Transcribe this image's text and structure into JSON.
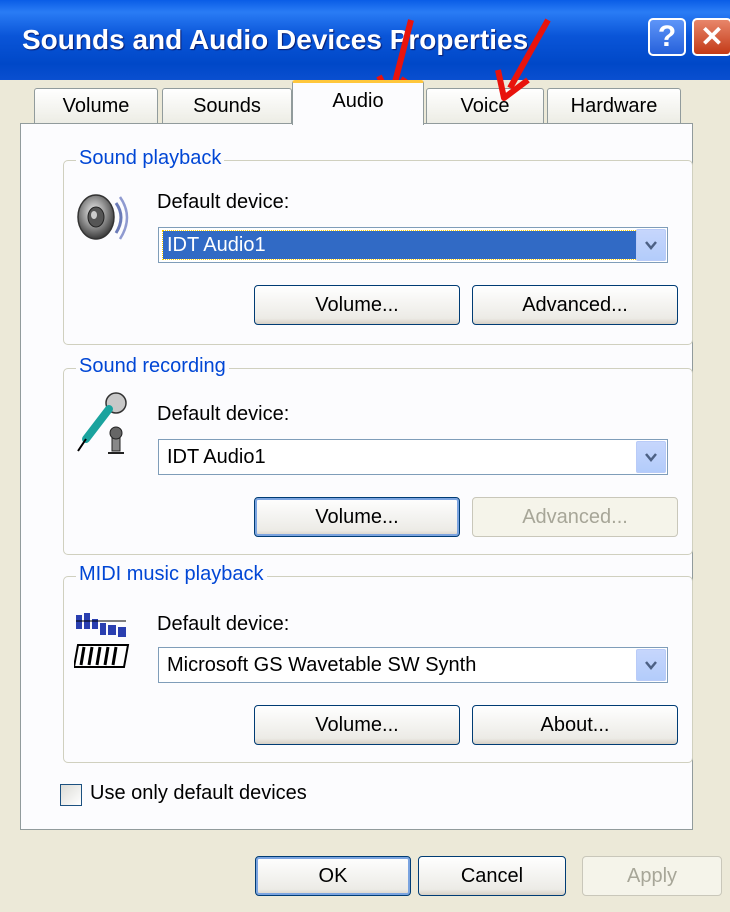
{
  "window": {
    "title": "Sounds and Audio Devices Properties"
  },
  "tabs": [
    {
      "label": "Volume"
    },
    {
      "label": "Sounds"
    },
    {
      "label": "Audio"
    },
    {
      "label": "Voice"
    },
    {
      "label": "Hardware"
    }
  ],
  "playback": {
    "group_title": "Sound playback",
    "default_label": "Default device:",
    "device": "IDT Audio1",
    "volume_button": "Volume...",
    "advanced_button": "Advanced..."
  },
  "recording": {
    "group_title": "Sound recording",
    "default_label": "Default device:",
    "device": "IDT Audio1",
    "volume_button": "Volume...",
    "advanced_button": "Advanced..."
  },
  "midi": {
    "group_title": "MIDI music playback",
    "default_label": "Default device:",
    "device": "Microsoft GS Wavetable SW Synth",
    "volume_button": "Volume...",
    "about_button": "About..."
  },
  "use_default_only": {
    "label": "Use only default devices",
    "checked": false
  },
  "footer": {
    "ok": "OK",
    "cancel": "Cancel",
    "apply": "Apply"
  },
  "colors": {
    "titlebar": "#0054E3",
    "group_title": "#0046D5",
    "selection": "#316AC5",
    "annotation_arrow": "#E8130C"
  },
  "icons": [
    "help-icon",
    "close-icon",
    "speaker-icon",
    "microphone-icon",
    "midi-keyboard-icon",
    "chevron-down-icon"
  ]
}
